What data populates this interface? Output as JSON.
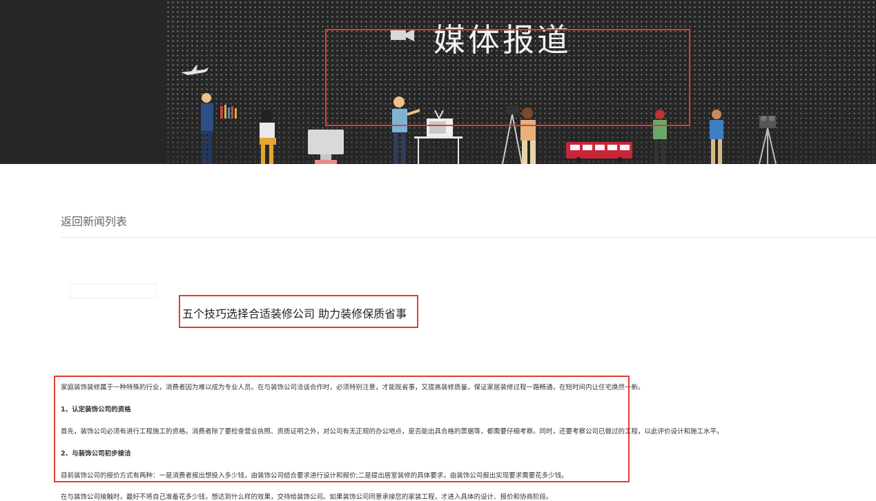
{
  "banner": {
    "title": "媒体报道",
    "icons": [
      "camera-icon",
      "airplane-icon",
      "tv-icon",
      "bus-icon",
      "tripod-camera-icon"
    ]
  },
  "nav": {
    "back_label": "返回新闻列表"
  },
  "article": {
    "title": "五个技巧选择合适装修公司 助力装修保质省事",
    "paragraphs": [
      "家庭装饰装修属于一种特殊的行业，消费者因为难以成为专业人员。在与装饰公司洽谈合作时，必须特别注意，才能既省事，又提高装修质量，保证家居装修过程一路畅通，在短时间内让住宅焕然一新。",
      "1、认定装饰公司的资格",
      "首先，装饰公司必须有进行工程施工的资格。消费者除了要检查营业执照、资质证明之外，对公司有无正规的办公地点，是否能出具合格的票据等，都需要仔细考察。同时，还要考察公司已做过的工程，以此评价设计和施工水平。",
      "2、与装饰公司初步接洽",
      "目前装饰公司的报价方式有两种：一是消费者报出想投入多少钱，由装饰公司结合要求进行设计和报价;二是提出居室装修的具体要求，由装饰公司报出实现要求需要花多少钱。",
      "在与装饰公司接触时，最好不将自己准备花多少钱，想达到什么样的效果，交待给装饰公司。如果装饰公司同意承接您的家装工程，才进入具体的设计、报价和协商阶段。"
    ]
  },
  "colors": {
    "banner_bg": "#262626",
    "highlight": "#e53935"
  }
}
